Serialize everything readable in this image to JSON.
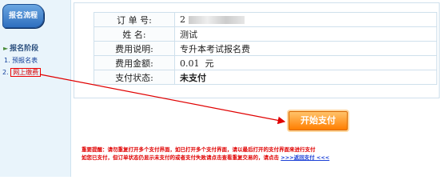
{
  "sidebar": {
    "logo_label": "报名流程",
    "phase_label": "报名阶段",
    "items": [
      {
        "label": "1. 预报名表"
      },
      {
        "label": "网上缴费",
        "prefix": "2."
      }
    ]
  },
  "info": {
    "rows": [
      {
        "label": "订 单 号:",
        "value": "2"
      },
      {
        "label": "姓    名:",
        "value": "测试"
      },
      {
        "label": "费用说明:",
        "value": "专升本考试报名费"
      },
      {
        "label": "费用金额:",
        "value": "0.01  元"
      },
      {
        "label": "支付状态:",
        "value": "未支付"
      }
    ]
  },
  "pay_button": "开始支付",
  "notice": {
    "text": "重要提醒：请勿重复打开多个支付界面，如已打开多个支付界面，请以最后打开的支付界面来进行支付",
    "text2": "如您已支付，但订单状态仍显示未支付的或者支付失败请点击查看重复交易的，请点击",
    "link": ">>>返回支付 <<<"
  },
  "colors": {
    "accent_red": "#e00000",
    "button_orange": "#ff7e00",
    "sidebar_bg": "#e9f4fb"
  }
}
